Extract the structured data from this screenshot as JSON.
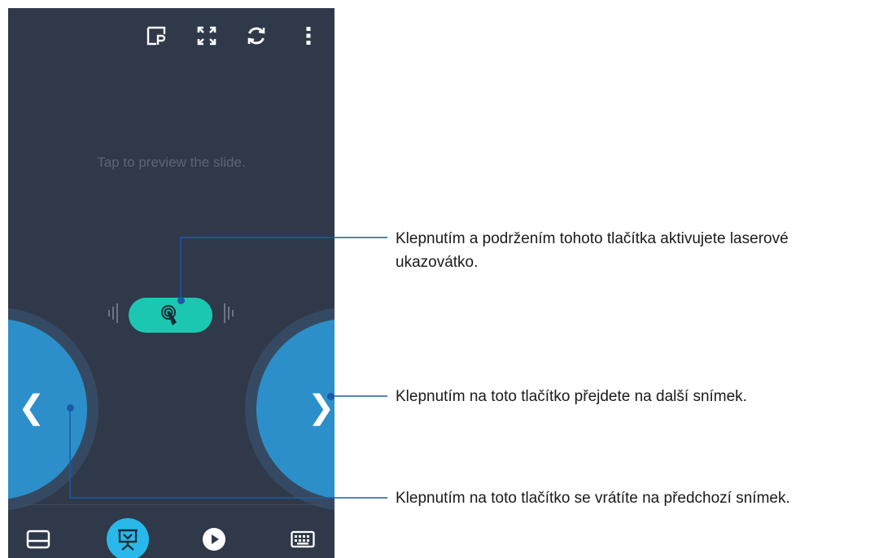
{
  "toolbar": {
    "icons": [
      "presentation-icon",
      "fullscreen-icon",
      "refresh-icon",
      "more-vert-icon"
    ]
  },
  "main": {
    "hint_text": "Tap to preview the slide."
  },
  "controls": {
    "prev_glyph": "❮",
    "next_glyph": "❯",
    "laser_icon": "touch-pointer-icon"
  },
  "bottom_nav": {
    "icons": [
      "touchpad-icon",
      "presenter-icon",
      "play-icon",
      "keyboard-icon"
    ],
    "active": "presenter-icon"
  },
  "callouts": {
    "laser": "Klepnutím a podržením tohoto tlačítka aktivujete laserové ukazovátko.",
    "next": "Klepnutím na toto tlačítko přejdete na další snímek.",
    "prev": "Klepnutím na toto tlačítko se vrátíte na předchozí snímek."
  },
  "colors": {
    "background": "#2f394a",
    "accent_blue": "#2d8fc9",
    "accent_teal": "#1cc7b1",
    "active_nav": "#29b8ea",
    "callout_line": "#1a5aa8"
  }
}
